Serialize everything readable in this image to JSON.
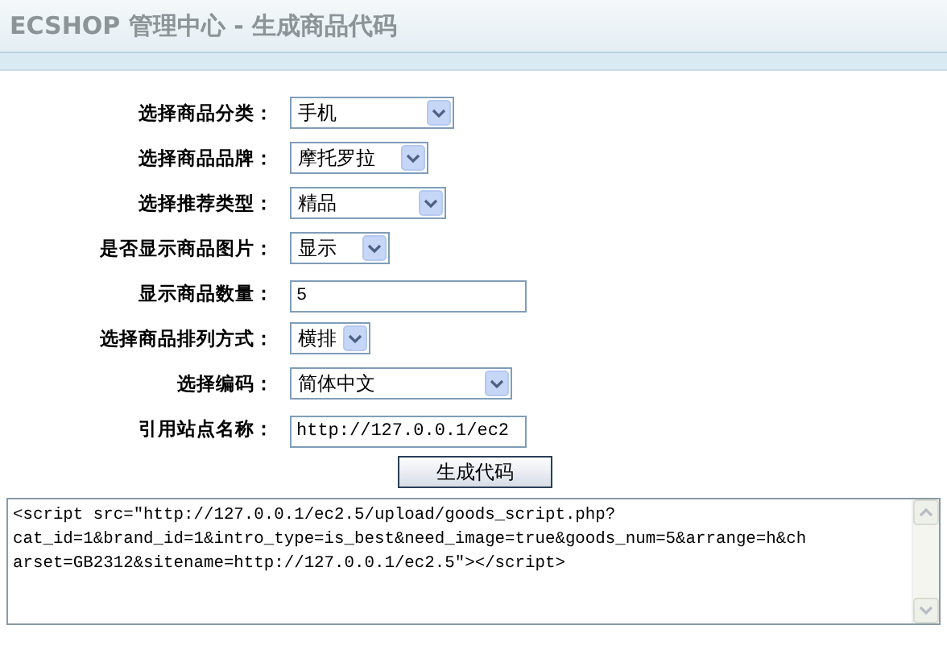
{
  "header": {
    "title": "ECSHOP 管理中心",
    "subtitle": " - 生成商品代码"
  },
  "form": {
    "rows": [
      {
        "label": "选择商品分类：",
        "kind": "select",
        "value": "手机"
      },
      {
        "label": "选择商品品牌：",
        "kind": "select",
        "value": "摩托罗拉"
      },
      {
        "label": "选择推荐类型：",
        "kind": "select",
        "value": "精品"
      },
      {
        "label": "是否显示商品图片：",
        "kind": "select",
        "value": "显示"
      },
      {
        "label": "显示商品数量：",
        "kind": "input",
        "value": "5"
      },
      {
        "label": "选择商品排列方式：",
        "kind": "select",
        "value": "横排"
      },
      {
        "label": "选择编码：",
        "kind": "select",
        "value": "简体中文"
      },
      {
        "label": "引用站点名称：",
        "kind": "input",
        "value": "http://127.0.0.1/ec2"
      }
    ],
    "submit": "生成代码"
  },
  "code_output": {
    "value": "<script src=\"http://127.0.0.1/ec2.5/upload/goods_script.php?\ncat_id=1&brand_id=1&intro_type=is_best&need_image=true&goods_num=5&arrange=h&ch\narset=GB2312&sitename=http://127.0.0.1/ec2.5\"></script>"
  }
}
